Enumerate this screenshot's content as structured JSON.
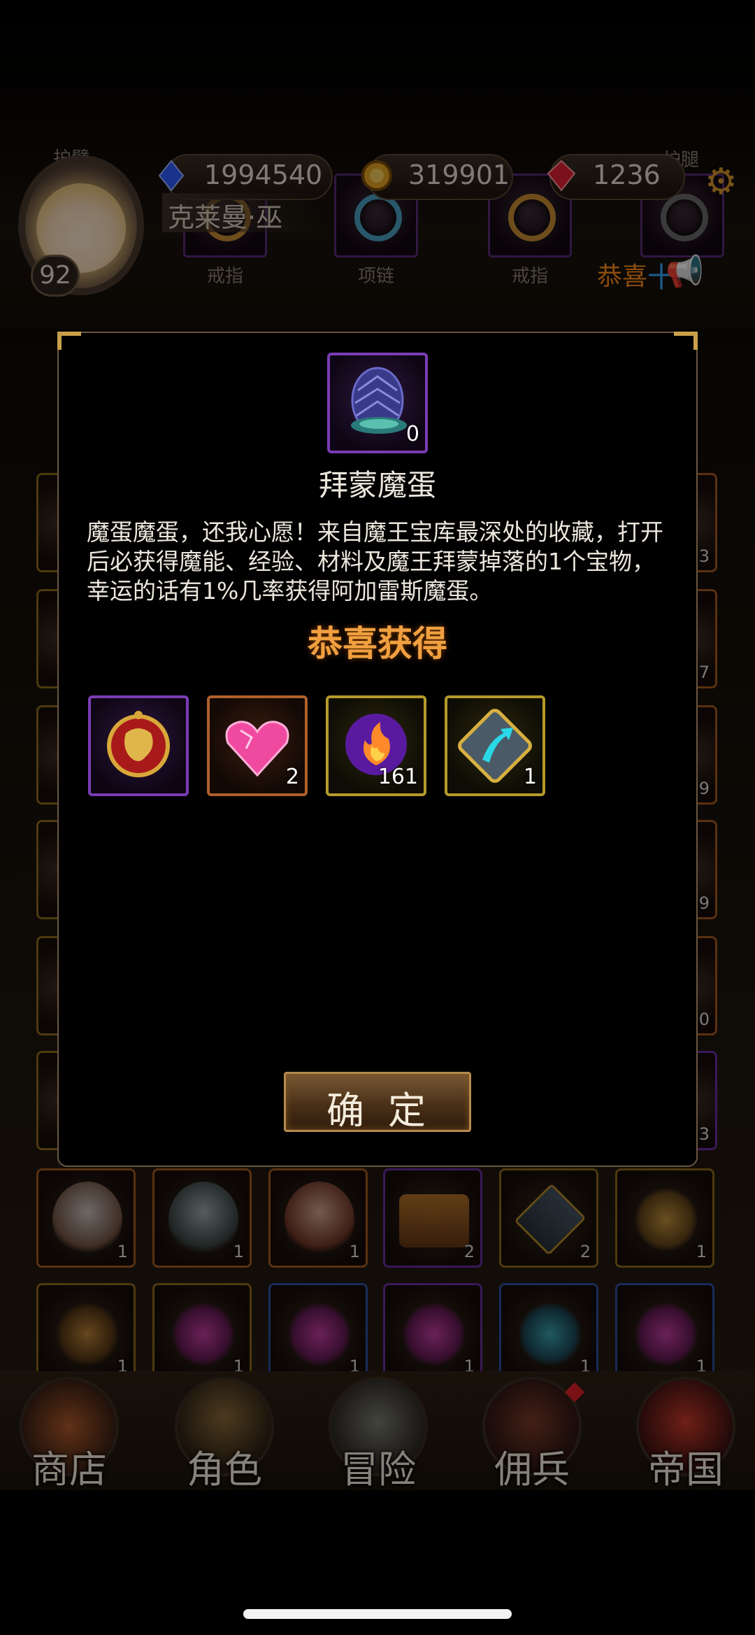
{
  "header": {
    "player_name": "克莱曼·巫",
    "level": "92",
    "resources": [
      {
        "name": "blue-crystal",
        "value": "1994540",
        "color": "#2f5cff"
      },
      {
        "name": "gold-coin",
        "value": "319901",
        "color": "#e8a424"
      },
      {
        "name": "red-gem",
        "value": "1236",
        "color": "#e02030"
      }
    ],
    "congrats_link": "恭喜",
    "congrats_plus": "十",
    "equip_labels": {
      "top_left": "护臂",
      "top_right": "护腿",
      "ring_left": "戒指",
      "necklace": "项链",
      "ring_right": "戒指"
    }
  },
  "modal": {
    "item_count": "0",
    "item_title": "拜蒙魔蛋",
    "description_lines": [
      "魔蛋魔蛋，还我心愿！来自魔王宝库最深处的收藏，打开",
      "后必获得魔能、经验、材料及魔王拜蒙掉落的1个宝物，",
      "幸运的话有1%几率获得阿加雷斯魔蛋。"
    ],
    "reward_title": "恭喜获得",
    "rewards": [
      {
        "icon": "dragon-amulet-icon",
        "count": ""
      },
      {
        "icon": "pink-heart-gem-icon",
        "count": "2"
      },
      {
        "icon": "fire-orb-icon",
        "count": "161"
      },
      {
        "icon": "upgrade-arrow-icon",
        "count": "1"
      }
    ],
    "confirm_label": "确定"
  },
  "inventory": {
    "row1_counts": [
      "1",
      "1",
      "1",
      "2",
      "2",
      "1"
    ],
    "row2_counts": [
      "1",
      "1",
      "1",
      "1",
      "1",
      "1"
    ],
    "right_edge_counts": [
      "3",
      "7",
      "9",
      "9",
      "0",
      "3"
    ]
  },
  "nav": {
    "items": [
      {
        "label": "商店"
      },
      {
        "label": "角色"
      },
      {
        "label": "冒险"
      },
      {
        "label": "佣兵"
      },
      {
        "label": "帝国"
      }
    ]
  }
}
